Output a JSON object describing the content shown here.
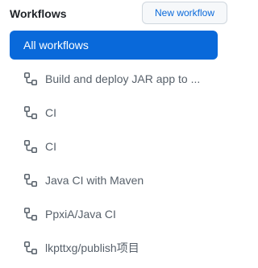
{
  "header": {
    "title": "Workflows",
    "new_button_label": "New workflow"
  },
  "nav": {
    "all_label": "All workflows",
    "workflows": [
      {
        "label": "Build and deploy JAR app to ...",
        "icon": "workflow-icon"
      },
      {
        "label": "CI",
        "icon": "workflow-icon"
      },
      {
        "label": "CI",
        "icon": "workflow-icon"
      },
      {
        "label": "Java CI with Maven",
        "icon": "workflow-icon"
      },
      {
        "label": "PpxiA/Java CI",
        "icon": "workflow-icon"
      },
      {
        "label": "lkpttxg/publish项目",
        "icon": "workflow-icon"
      }
    ]
  },
  "colors": {
    "accent": "#0969da",
    "muted_text": "#57606a",
    "button_bg": "#f6f8fa"
  }
}
